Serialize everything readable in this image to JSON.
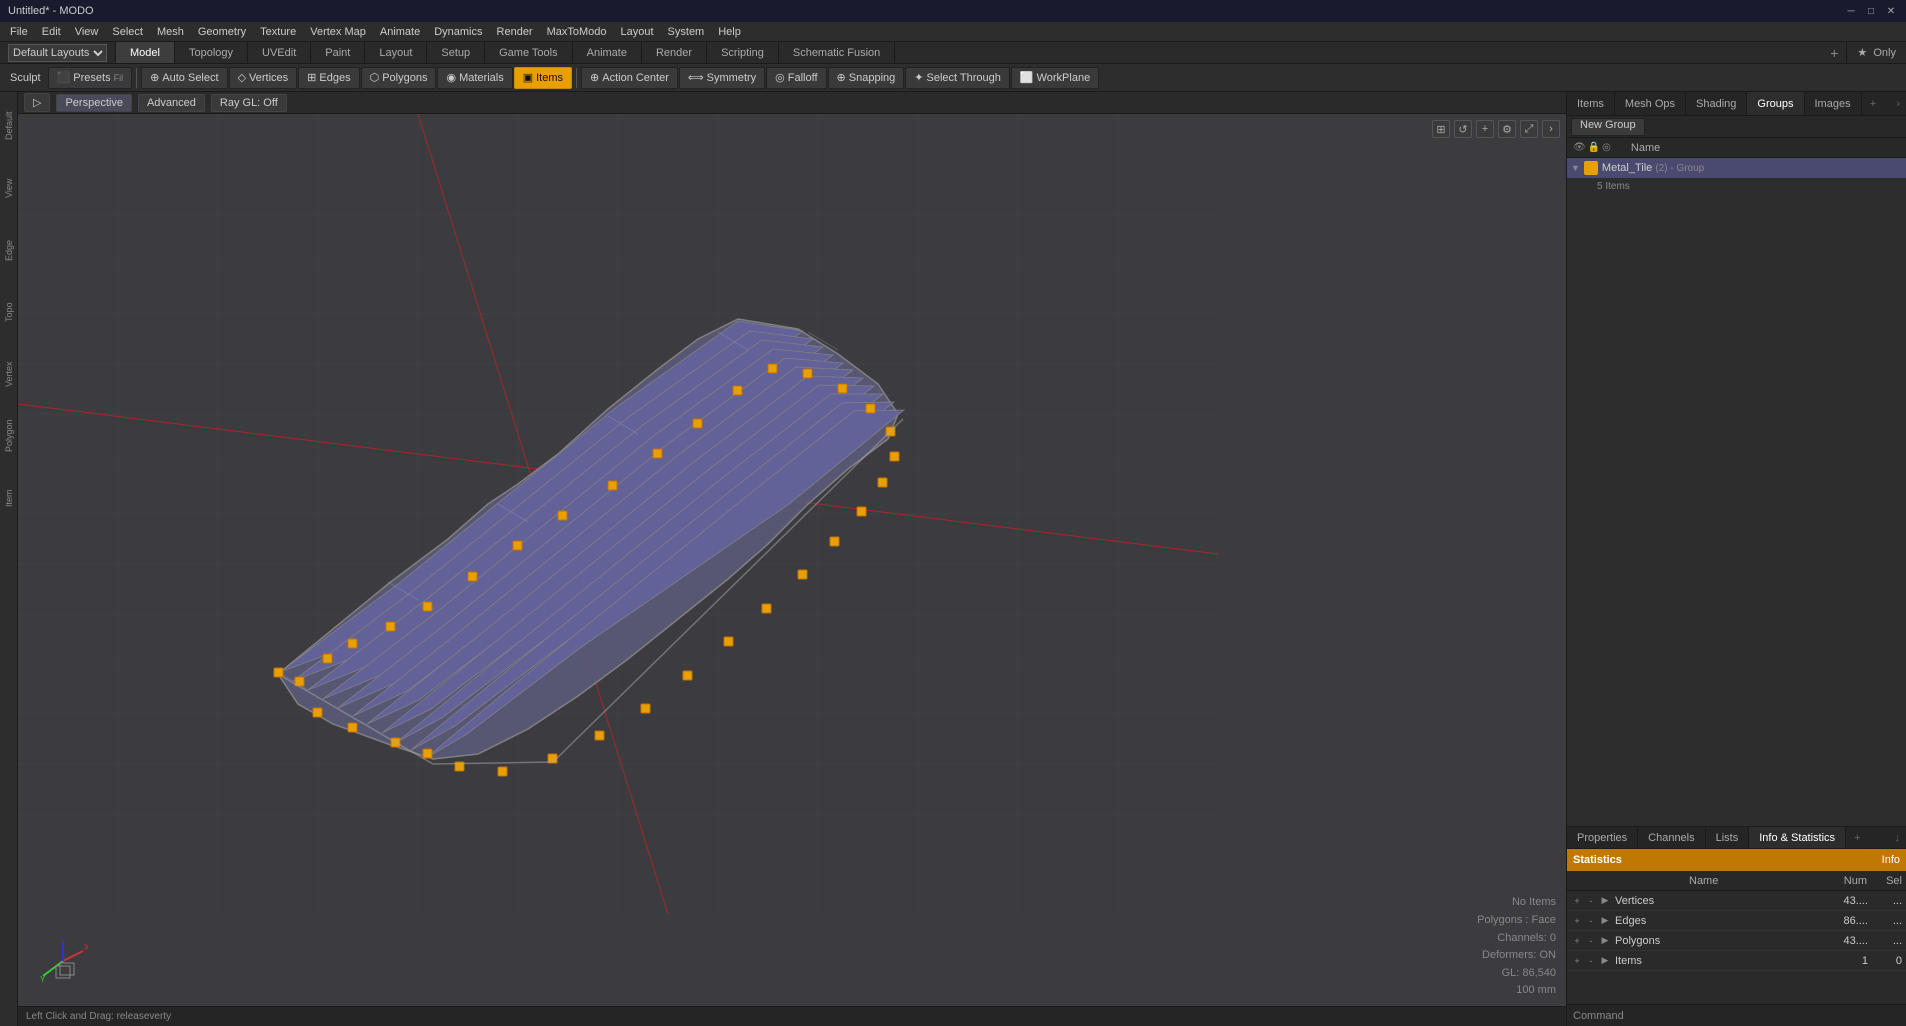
{
  "titleBar": {
    "title": "Untitled* - MODO",
    "minimize": "─",
    "restore": "□",
    "close": "✕"
  },
  "menuBar": {
    "items": [
      "File",
      "Edit",
      "View",
      "Select",
      "Mesh",
      "Geometry",
      "Texture",
      "Vertex Map",
      "Animate",
      "Dynamics",
      "Render",
      "MaxToModo",
      "Layout",
      "System",
      "Help"
    ]
  },
  "layoutDropdown": "Default Layouts",
  "modeTabs": {
    "tabs": [
      "Model",
      "Topology",
      "UVEdit",
      "Paint",
      "Layout",
      "Setup",
      "Game Tools",
      "Animate",
      "Render",
      "Scripting",
      "Schematic Fusion"
    ],
    "active": "Model",
    "onlyLabel": "★  Only"
  },
  "toolbar": {
    "sculpt": "Sculpt",
    "presets": "Presets",
    "autoSelect": "Auto Select",
    "vertices": "Vertices",
    "edges": "Edges",
    "polygons": "Polygons",
    "materials": "Materials",
    "items": "Items",
    "actionCenter": "Action Center",
    "symmetry": "Symmetry",
    "falloff": "Falloff",
    "snapping": "Snapping",
    "selectThrough": "Select Through",
    "workplane": "WorkPlane"
  },
  "viewport": {
    "perspective": "Perspective",
    "advanced": "Advanced",
    "rayGL": "Ray GL: Off"
  },
  "viewportStatus": {
    "noItems": "No Items",
    "polygons": "Polygons : Face",
    "channels": "Channels: 0",
    "deformers": "Deformers: ON",
    "gl": "GL: 86,540",
    "size": "100 mm"
  },
  "bottomBar": {
    "leftClick": "Left Click and Drag:  releaseverty"
  },
  "rightPanel": {
    "tabs": [
      "Items",
      "Mesh Ops",
      "Shading",
      "Groups",
      "Images"
    ],
    "active": "Groups",
    "newGroup": "New Group",
    "nameHeader": "Name",
    "groupItem": {
      "name": "Metal_Tile",
      "tag": "(2) - Group",
      "subInfo": "5 Items"
    }
  },
  "bottomPanel": {
    "tabs": [
      "Properties",
      "Channels",
      "Lists",
      "Info & Statistics"
    ],
    "active": "Info & Statistics",
    "addTab": "+",
    "statsLabel": "Statistics",
    "infoLabel": "Info",
    "columns": {
      "name": "Name",
      "num": "Num",
      "sel": "Sel"
    },
    "rows": [
      {
        "name": "Vertices",
        "num": "43....",
        "sel": "..."
      },
      {
        "name": "Edges",
        "num": "86....",
        "sel": "..."
      },
      {
        "name": "Polygons",
        "num": "43....",
        "sel": "..."
      },
      {
        "name": "Items",
        "num": "1",
        "sel": "0"
      }
    ]
  }
}
